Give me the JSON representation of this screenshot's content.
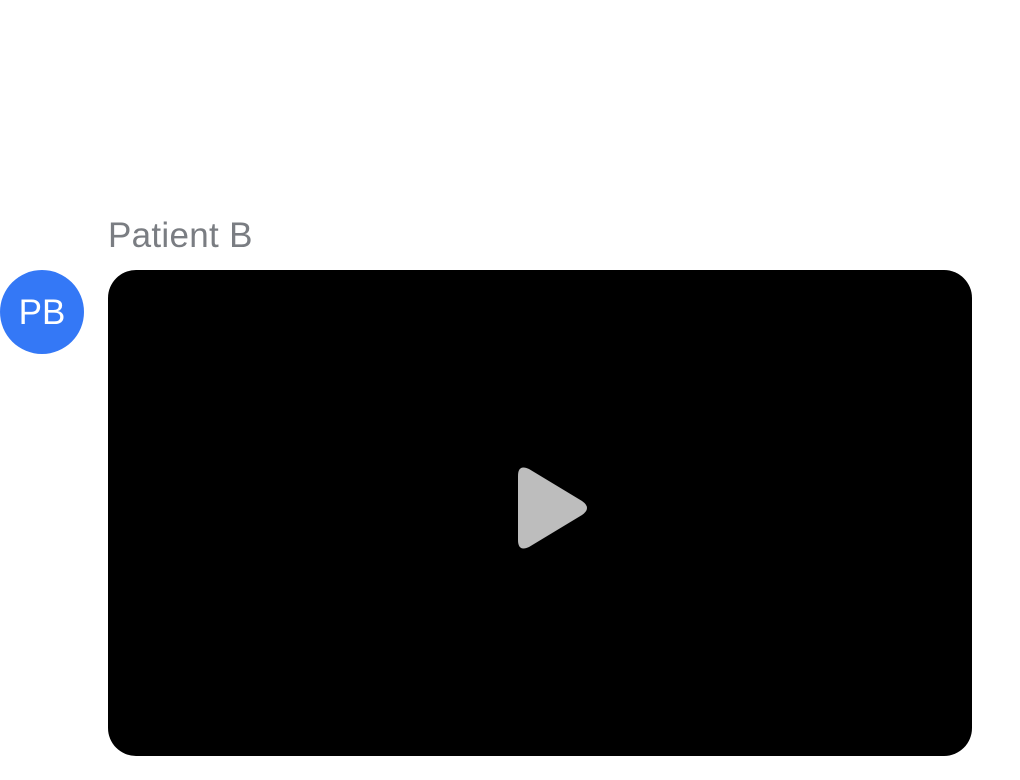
{
  "message": {
    "sender_name": "Patient B",
    "avatar_initials": "PB",
    "avatar_color": "#3478f6",
    "attachment": {
      "type": "video",
      "background_color": "#000000",
      "play_icon": "play-icon",
      "play_icon_color": "#bdbdbd"
    }
  }
}
